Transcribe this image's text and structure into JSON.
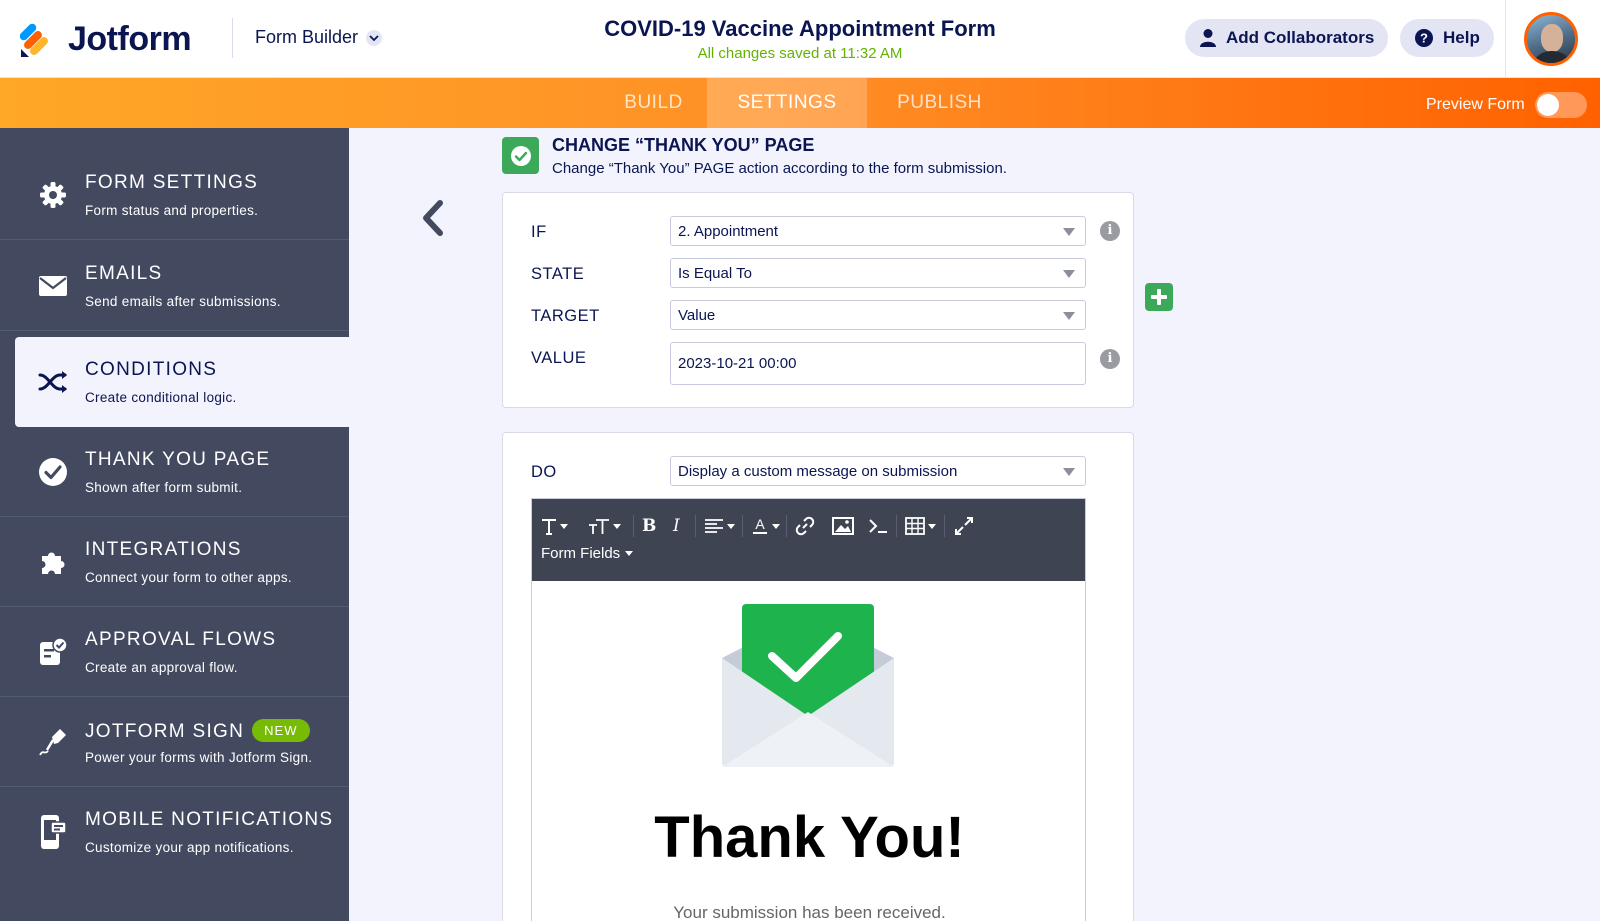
{
  "app": {
    "logo_text": "Jotform",
    "section_label": "Form Builder"
  },
  "form": {
    "title": "COVID-19 Vaccine Appointment Form",
    "save_status": "All changes saved at 11:32 AM"
  },
  "header_buttons": {
    "collaborators": "Add Collaborators",
    "help": "Help"
  },
  "tabs": [
    {
      "label": "BUILD"
    },
    {
      "label": "SETTINGS"
    },
    {
      "label": "PUBLISH"
    }
  ],
  "preview": {
    "label": "Preview Form"
  },
  "sidebar": {
    "items": [
      {
        "title": "FORM SETTINGS",
        "subtitle": "Form status and properties.",
        "icon": "gear-icon"
      },
      {
        "title": "EMAILS",
        "subtitle": "Send emails after submissions.",
        "icon": "envelope-icon"
      },
      {
        "title": "CONDITIONS",
        "subtitle": "Create conditional logic.",
        "icon": "shuffle-icon"
      },
      {
        "title": "THANK YOU PAGE",
        "subtitle": "Shown after form submit.",
        "icon": "check-circle-icon"
      },
      {
        "title": "INTEGRATIONS",
        "subtitle": "Connect your form to other apps.",
        "icon": "puzzle-icon"
      },
      {
        "title": "APPROVAL FLOWS",
        "subtitle": "Create an approval flow.",
        "icon": "approval-icon"
      },
      {
        "title": "JOTFORM SIGN",
        "subtitle": "Power your forms with Jotform Sign.",
        "icon": "pen-icon",
        "badge": "NEW"
      },
      {
        "title": "MOBILE NOTIFICATIONS",
        "subtitle": "Customize your app notifications.",
        "icon": "mobile-icon"
      }
    ]
  },
  "condition": {
    "title": "CHANGE “THANK YOU” PAGE",
    "subtitle": "Change “Thank You” PAGE action according to the form submission.",
    "if": {
      "label": "IF",
      "value": "2. Appointment"
    },
    "state": {
      "label": "STATE",
      "value": "Is Equal To"
    },
    "target": {
      "label": "TARGET",
      "value": "Value"
    },
    "value": {
      "label": "VALUE",
      "value": "2023-10-21 00:00"
    },
    "do": {
      "label": "DO",
      "value": "Display a custom message on submission"
    }
  },
  "editor": {
    "form_fields_label": "Form Fields",
    "heading": "Thank You!",
    "message": "Your submission has been received."
  },
  "colors": {
    "accent": "#ff6100",
    "success": "#3ba85a",
    "save": "#64b200",
    "sidebar": "#434a60"
  }
}
